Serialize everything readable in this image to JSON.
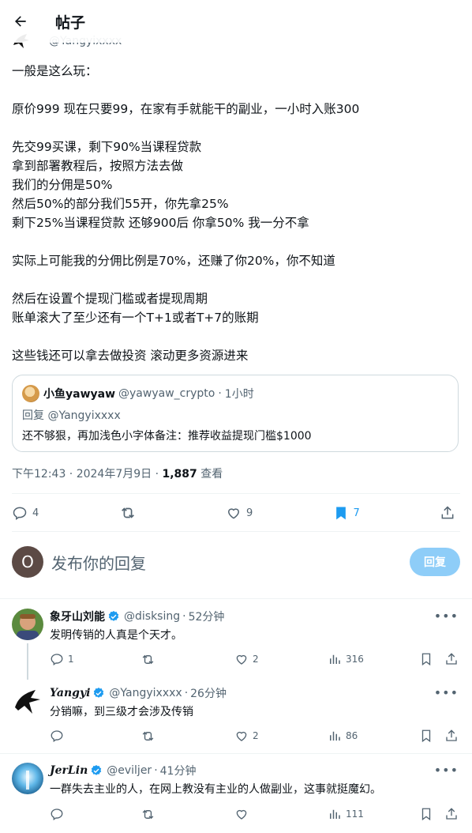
{
  "header": {
    "title": "帖子"
  },
  "post": {
    "handle": "@Yangyixxxx",
    "text": "一般是这么玩：\n\n原价999 现在只要99，在家有手就能干的副业，一小时入账300\n\n先交99买课，剩下90%当课程贷款\n拿到部署教程后，按照方法去做\n我们的分佣是50%\n然后50%的部分我们55开，你先拿25%\n剩下25%当课程贷款 还够900后 你拿50% 我一分不拿\n\n实际上可能我的分佣比例是70%，还赚了你20%，你不知道\n\n然后在设置个提现门槛或者提现周期\n账单滚大了至少还有一个T+1或者T+7的账期\n\n这些钱还可以拿去做投资 滚动更多资源进来",
    "quote": {
      "name": "小鱼yawyaw",
      "handle": "@yawyaw_crypto",
      "dot": "·",
      "time": "1小时",
      "reply_to": "回复 @Yangyixxxx",
      "text": "还不够狠，再加浅色小字体备注：推荐收益提现门槛$1000"
    },
    "timestamp": "下午12:43 · 2024年7月9日 · ",
    "views": "1,887",
    "views_label": " 查看",
    "stats": {
      "replies": "4",
      "reposts": "",
      "likes": "9",
      "bookmarks": "7"
    }
  },
  "composer": {
    "placeholder": "发布你的回复",
    "avatar_letter": "O",
    "button": "回复"
  },
  "replies": [
    {
      "name": "象牙山刘能",
      "handle": "@disksing",
      "dot": "·",
      "time": "52分钟",
      "text": "发明传销的人真是个天才。",
      "replies": "1",
      "reposts": "",
      "likes": "2",
      "views": "316"
    },
    {
      "name": "Yangyi",
      "handle": "@Yangyixxxx",
      "dot": "·",
      "time": "26分钟",
      "text": "分销嘛，到三级才会涉及传销",
      "replies": "",
      "reposts": "",
      "likes": "2",
      "views": "86"
    },
    {
      "name": "JerLin",
      "handle": "@eviljer",
      "dot": "·",
      "time": "41分钟",
      "text": "一群失去主业的人，在网上教没有主业的人做副业，这事就挺魔幻。",
      "replies": "",
      "reposts": "",
      "likes": "",
      "views": "111"
    }
  ],
  "colors": {
    "accent": "#1d9bf0",
    "muted": "#536471",
    "border": "#cfd9de",
    "reply_button": "#8ecdf8"
  }
}
